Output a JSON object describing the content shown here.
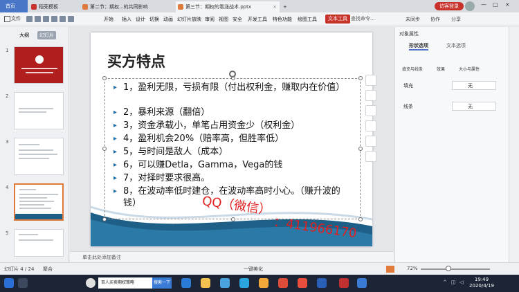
{
  "tabs": [
    {
      "label": "首页"
    },
    {
      "label": "稻壳模板"
    },
    {
      "label": "第二节：期权...的共同影响"
    },
    {
      "label": "第三节：期权的看涨战术.pptx"
    }
  ],
  "window": {
    "login_label": "访客登录",
    "minimize": "—",
    "maximize": "□",
    "close": "×"
  },
  "ribbon": {
    "file_label": "文件",
    "menus": [
      "开始",
      "插入",
      "设计",
      "切换",
      "动画",
      "幻灯片放映",
      "审阅",
      "视图",
      "安全",
      "开发工具",
      "特色功能",
      "绘图工具"
    ],
    "active_tool": "文本工具",
    "search_placeholder": "查找命令...",
    "sync_label": "未同步",
    "collab_label": "协作",
    "share_label": "分享"
  },
  "left_panel": {
    "tab_outline": "大纲",
    "tab_slides": "幻灯片",
    "thumb_numbers": [
      "1",
      "2",
      "3",
      "4",
      "5"
    ]
  },
  "slide": {
    "title": "买方特点",
    "bullets": [
      {
        "text": "1，盈利无限，亏损有限（付出权利金，赚取内在价值）"
      },
      {
        "text": "2，暴利来源（翻倍）"
      },
      {
        "text": "3，资金承载小，单笔占用资金少（权利金）"
      },
      {
        "text": "4，盈利机会20%（赔率高，但胜率低）"
      },
      {
        "text": "5，与时间是敌人（成本）"
      },
      {
        "text": "6，可以赚Detla，Gamma，Vega的钱"
      },
      {
        "text": "7，对择时要求很高。"
      },
      {
        "text": "8，在波动率低时建仓，在波动率高时小心。（赚升波的钱）"
      }
    ]
  },
  "notes": {
    "placeholder": "单击此处添加备注"
  },
  "right_panel": {
    "title": "对象属性",
    "tab_shape": "形状选项",
    "tab_text": "文本选项",
    "sub_fill": "填充与线条",
    "sub_effect": "效果",
    "sub_size": "大小与属性",
    "fill_label": "填充",
    "fill_value": "无",
    "line_label": "线条",
    "line_value": "无"
  },
  "status": {
    "slide_counter": "幻灯片 4 / 24",
    "theme": "聚合",
    "beautify": "一键美化",
    "zoom": "72%"
  },
  "taskbar": {
    "search_text": "百人买卖期权策略",
    "search_button": "搜索一下",
    "time": "19:49",
    "date": "2020/4/19"
  },
  "watermark": {
    "line1": "QQ（微信）",
    "line2": "：411966170"
  },
  "colors": {
    "accent": "#c9322b",
    "bullet": "#1b6ea8",
    "watermark": "#e02020",
    "wave": "#1d5f86"
  }
}
